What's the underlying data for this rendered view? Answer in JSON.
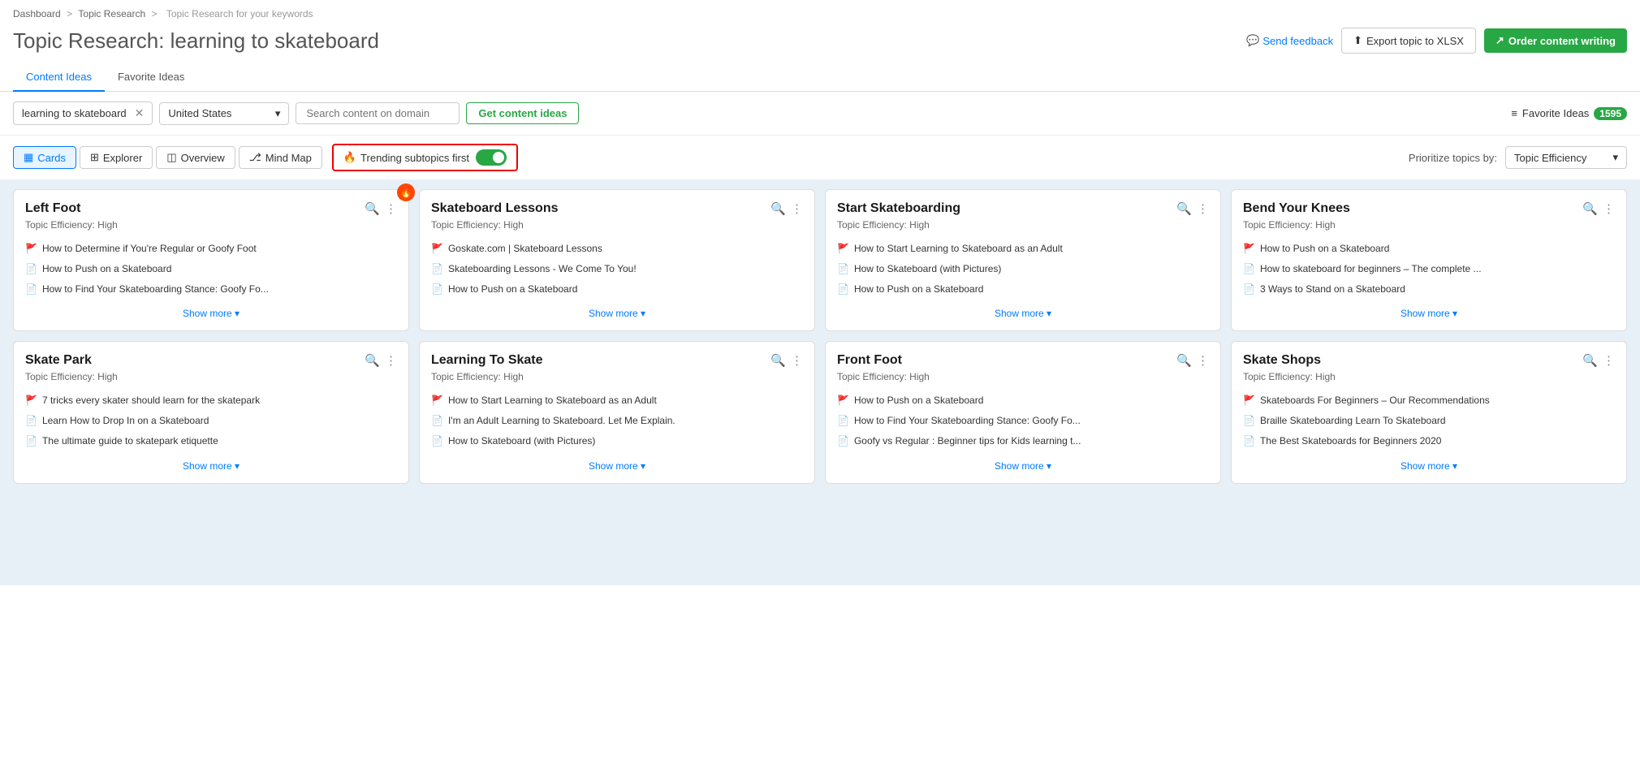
{
  "breadcrumb": {
    "items": [
      "Dashboard",
      "Topic Research",
      "Topic Research for your keywords"
    ]
  },
  "header": {
    "title_prefix": "Topic Research:",
    "title_keyword": "learning to skateboard",
    "send_feedback": "Send feedback",
    "export_btn": "Export topic to XLSX",
    "order_btn": "Order content writing"
  },
  "tabs": [
    {
      "id": "content-ideas",
      "label": "Content Ideas",
      "active": true
    },
    {
      "id": "favorite-ideas",
      "label": "Favorite Ideas",
      "active": false
    }
  ],
  "filters": {
    "keyword": "learning to skateboard",
    "country": "United States",
    "domain_placeholder": "Search content on domain",
    "get_ideas_btn": "Get content ideas",
    "favorite_label": "Favorite Ideas",
    "favorite_count": "1595"
  },
  "view_controls": {
    "views": [
      {
        "id": "cards",
        "label": "Cards",
        "active": true
      },
      {
        "id": "explorer",
        "label": "Explorer",
        "active": false
      },
      {
        "id": "overview",
        "label": "Overview",
        "active": false
      },
      {
        "id": "mindmap",
        "label": "Mind Map",
        "active": false
      }
    ],
    "trending_label": "Trending subtopics first",
    "trending_on": true,
    "prioritize_label": "Prioritize topics by:",
    "priority_select": "Topic Efficiency"
  },
  "cards": [
    {
      "id": "left-foot",
      "title": "Left Foot",
      "efficiency": "Topic Efficiency:  High",
      "hot": true,
      "items": [
        {
          "type": "green",
          "text": "How to Determine if You're Regular or Goofy Foot"
        },
        {
          "type": "blue",
          "text": "How to Push on a Skateboard"
        },
        {
          "type": "blue",
          "text": "How to Find Your Skateboarding Stance: Goofy Fo..."
        }
      ]
    },
    {
      "id": "skateboard-lessons",
      "title": "Skateboard Lessons",
      "efficiency": "Topic Efficiency:  High",
      "hot": false,
      "items": [
        {
          "type": "green",
          "text": "Goskate.com | Skateboard Lessons"
        },
        {
          "type": "blue",
          "text": "Skateboarding Lessons - We Come To You!"
        },
        {
          "type": "blue",
          "text": "How to Push on a Skateboard"
        }
      ]
    },
    {
      "id": "start-skateboarding",
      "title": "Start Skateboarding",
      "efficiency": "Topic Efficiency:  High",
      "hot": false,
      "items": [
        {
          "type": "green",
          "text": "How to Start Learning to Skateboard as an Adult"
        },
        {
          "type": "blue",
          "text": "How to Skateboard (with Pictures)"
        },
        {
          "type": "blue",
          "text": "How to Push on a Skateboard"
        }
      ]
    },
    {
      "id": "bend-your-knees",
      "title": "Bend Your Knees",
      "efficiency": "Topic Efficiency:  High",
      "hot": false,
      "items": [
        {
          "type": "green",
          "text": "How to Push on a Skateboard"
        },
        {
          "type": "blue",
          "text": "How to skateboard for beginners – The complete ..."
        },
        {
          "type": "blue",
          "text": "3 Ways to Stand on a Skateboard"
        }
      ]
    },
    {
      "id": "skate-park",
      "title": "Skate Park",
      "efficiency": "Topic Efficiency:  High",
      "hot": false,
      "items": [
        {
          "type": "green",
          "text": "7 tricks every skater should learn for the skatepark"
        },
        {
          "type": "blue",
          "text": "Learn How to Drop In on a Skateboard"
        },
        {
          "type": "blue",
          "text": "The ultimate guide to skatepark etiquette"
        }
      ]
    },
    {
      "id": "learning-to-skate",
      "title": "Learning To Skate",
      "efficiency": "Topic Efficiency:  High",
      "hot": false,
      "items": [
        {
          "type": "green",
          "text": "How to Start Learning to Skateboard as an Adult"
        },
        {
          "type": "blue",
          "text": "I'm an Adult Learning to Skateboard. Let Me Explain."
        },
        {
          "type": "blue",
          "text": "How to Skateboard (with Pictures)"
        }
      ]
    },
    {
      "id": "front-foot",
      "title": "Front Foot",
      "efficiency": "Topic Efficiency:  High",
      "hot": false,
      "items": [
        {
          "type": "green",
          "text": "How to Push on a Skateboard"
        },
        {
          "type": "blue",
          "text": "How to Find Your Skateboarding Stance: Goofy Fo..."
        },
        {
          "type": "blue",
          "text": "Goofy vs Regular : Beginner tips for Kids learning t..."
        }
      ]
    },
    {
      "id": "skate-shops",
      "title": "Skate Shops",
      "efficiency": "Topic Efficiency:  High",
      "hot": false,
      "items": [
        {
          "type": "green",
          "text": "Skateboards For Beginners – Our Recommendations"
        },
        {
          "type": "blue",
          "text": "Braille Skateboarding Learn To Skateboard"
        },
        {
          "type": "blue",
          "text": "The Best Skateboards for Beginners 2020"
        }
      ]
    }
  ],
  "show_more_label": "Show more",
  "icons": {
    "upload": "⬆",
    "external_link": "↗",
    "chat_bubble": "💬",
    "hamburger": "≡",
    "search": "🔍",
    "dots": "⋮",
    "chevron_down": "▾",
    "flame": "🔥",
    "grid": "▦",
    "table": "⊞",
    "overview": "◫",
    "mindmap": "⎇"
  }
}
